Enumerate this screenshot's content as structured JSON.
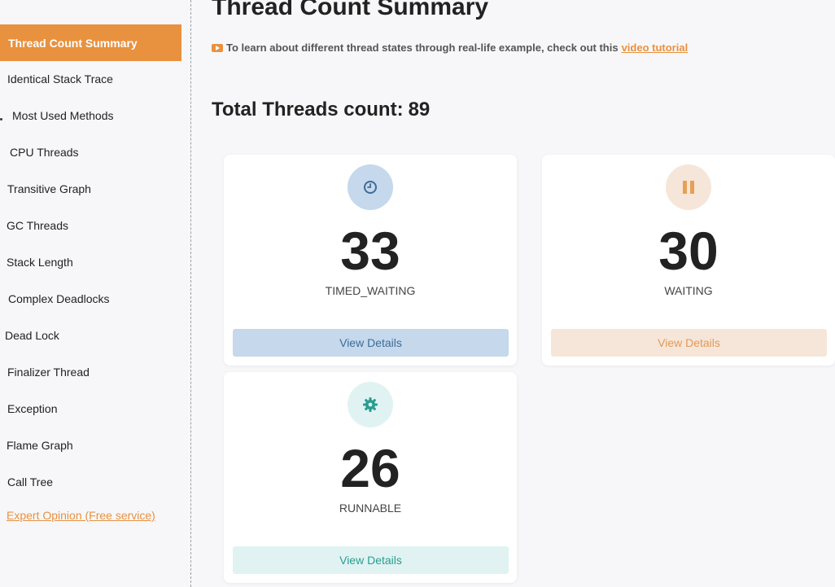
{
  "sidebar": {
    "active": "Thread Count Summary",
    "items": [
      "Identical Stack Trace",
      "Most Used Methods",
      "CPU Threads",
      "Transitive Graph",
      "GC Threads",
      "Stack Length",
      "Complex Deadlocks",
      "Dead Lock",
      "Finalizer Thread",
      "Exception",
      "Flame Graph",
      "Call Tree"
    ],
    "link": "Expert Opinion (Free service)"
  },
  "main": {
    "title": "Thread Count Summary",
    "tutorial_text": "To learn about different thread states through real-life example, check out this",
    "tutorial_link": "video tutorial",
    "total_label": "Total Threads count:",
    "total_value": "89"
  },
  "cards": [
    {
      "count": "33",
      "state": "TIMED_WAITING",
      "button": "View Details",
      "icon": "clock-icon",
      "color": "#3e6c97"
    },
    {
      "count": "30",
      "state": "WAITING",
      "button": "View Details",
      "icon": "pause-icon",
      "color": "#e39a55"
    },
    {
      "count": "26",
      "state": "RUNNABLE",
      "button": "View Details",
      "icon": "gear-icon",
      "color": "#2a9d91"
    }
  ]
}
